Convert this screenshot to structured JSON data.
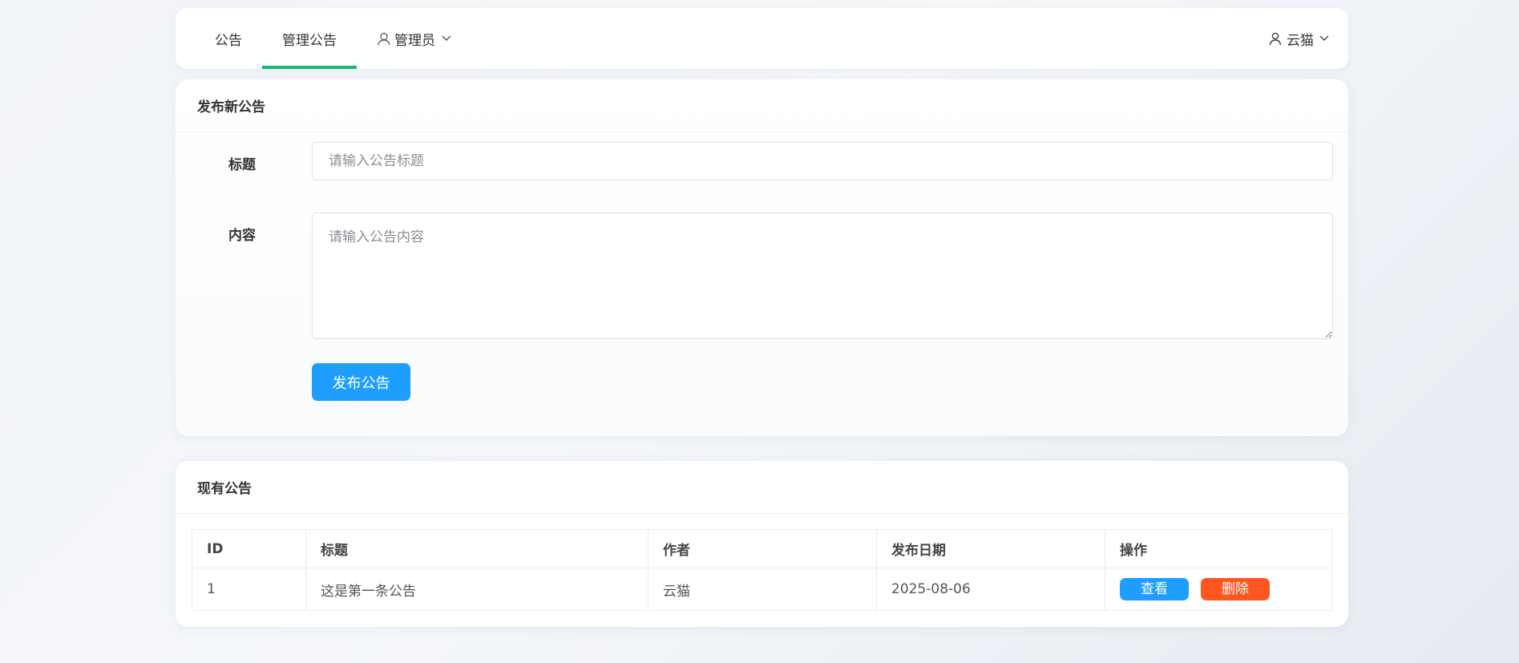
{
  "nav": {
    "items": [
      {
        "label": "公告"
      },
      {
        "label": "管理公告"
      },
      {
        "label": "管理员"
      }
    ],
    "user": "云猫",
    "accent": "#16b777"
  },
  "form": {
    "heading": "发布新公告",
    "title_label": "标题",
    "title_placeholder": "请输入公告标题",
    "content_label": "内容",
    "content_placeholder": "请输入公告内容",
    "submit_label": "发布公告"
  },
  "list": {
    "heading": "现有公告",
    "columns": [
      "ID",
      "标题",
      "作者",
      "发布日期",
      "操作"
    ],
    "rows": [
      {
        "id": "1",
        "title": "这是第一条公告",
        "author": "云猫",
        "date": "2025-08-06",
        "view": "查看",
        "delete": "删除"
      }
    ]
  },
  "colors": {
    "primary": "#1e9fff",
    "danger": "#ff5722"
  }
}
